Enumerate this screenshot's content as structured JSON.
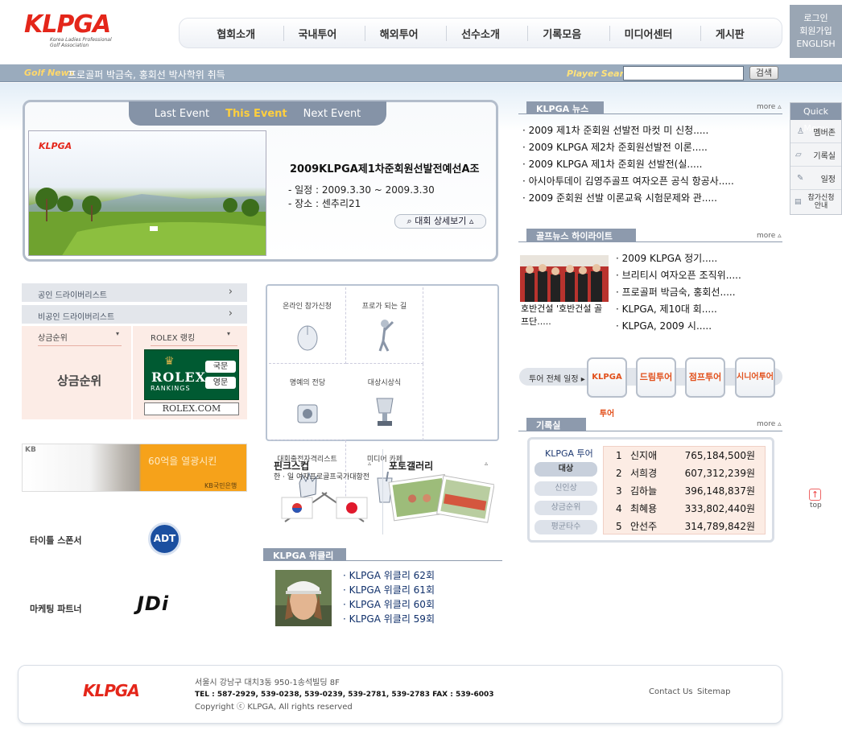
{
  "header": {
    "logo_text": "KLPGA",
    "logo_sub": "Korea Ladies Professional Golf Association",
    "nav": [
      "협회소개",
      "국내투어",
      "해외투어",
      "선수소개",
      "기록모음",
      "미디어센터",
      "게시판"
    ],
    "top_links": [
      "로그인",
      "회원가입",
      "ENGLISH"
    ]
  },
  "newsbar": {
    "label": "Golf News",
    "headline": "프로골퍼 박금숙, 홍회선 박사학위 취득",
    "search_label": "Player Search",
    "search_button": "검색"
  },
  "event": {
    "tabs": [
      "Last Event",
      "This Event",
      "Next Event"
    ],
    "title": "2009KLPGA제1차준회원선발전예선A조",
    "date": "- 일정 : 2009.3.30 ~ 2009.3.30",
    "venue": "- 장소 : 센추리21",
    "detail_button": "대회 상세보기"
  },
  "left": {
    "links": [
      "공인 드라이버리스트",
      "비공인 드라이버리스트"
    ],
    "prize_tab": "상금순위",
    "rolex_tab": "ROLEX 랭킹",
    "prize_title": "상금순위",
    "rolex_word": "ROLEX",
    "rolex_rankings": "RANKINGS",
    "rolex_kor": "국문",
    "rolex_eng": "영문",
    "rolex_site": "ROLEX.COM",
    "kb_logo": "KB",
    "kb_text": "60억을 열광시킨",
    "kb_bank": "KB국민은행",
    "sponsor_title": "타이틀 스폰서",
    "sponsor_logo": "ADT",
    "partner_title": "마케팅 파트너",
    "partner_logo": "JDi"
  },
  "grid": [
    "온라인 참가신청",
    "프로가 되는 길",
    "명예의 전당",
    "대상시상식",
    "대회출전자격리스트",
    "미디어 카페"
  ],
  "pinks": {
    "title": "핀크스컵",
    "subtitle": "한 · 일 여자프로골프국가대항전",
    "photo_title": "포토갤러리"
  },
  "weekly": {
    "header": "KLPGA 위클리",
    "items": [
      "· KLPGA 위클리 62회",
      "· KLPGA 위클리 61회",
      "· KLPGA 위클리 60회",
      "· KLPGA 위클리 59회"
    ]
  },
  "news": {
    "header": "KLPGA 뉴스",
    "more": "more ▵",
    "items": [
      "·  2009 제1차 준회원 선발전 마컷 미 신청.....",
      "·  2009 KLPGA 제2차 준회원선발전 이론.....",
      "·  2009 KLPGA 제1차 준회원 선발전(실.....",
      "·  아시아투데이 김영주골프 여자오픈 공식 항공사.....",
      "·  2009 준회원 선발 이론교육 시험문제와 관....."
    ]
  },
  "highlight": {
    "header": "골프뉴스 하이라이트",
    "more": "more ▵",
    "caption": "호반건설 '호반건설 골프단.....",
    "items": [
      "· 2009 KLPGA 정기.....",
      "· 브리티시 여자오픈 조직위.....",
      "· 프로골퍼 박금숙, 홍회선.....",
      "· KLPGA, 제10대 회.....",
      "· KLPGA, 2009 시....."
    ]
  },
  "tours": {
    "label": "투어 전체 일정 ▸",
    "items": [
      "KLPGA투어",
      "드림투어",
      "점프투어",
      "시니어투어"
    ]
  },
  "records": {
    "header": "기록실",
    "more": "more ▵",
    "tour": "KLPGA 투어",
    "tabs": [
      "대상",
      "신인상",
      "상금순위",
      "평균타수"
    ],
    "rows": [
      {
        "rank": "1",
        "name": "신지애",
        "amount": "765,184,500원"
      },
      {
        "rank": "2",
        "name": "서희경",
        "amount": "607,312,239원"
      },
      {
        "rank": "3",
        "name": "김하늘",
        "amount": "396,148,837원"
      },
      {
        "rank": "4",
        "name": "최혜용",
        "amount": "333,802,440원"
      },
      {
        "rank": "5",
        "name": "안선주",
        "amount": "314,789,842원"
      }
    ]
  },
  "quickmenu": {
    "header": "Quick Menu",
    "items": [
      "멤버존",
      "기록실",
      "일정",
      "참가신청 안내"
    ],
    "top": "top"
  },
  "footer": {
    "address": "서울시 강남구 대치3동 950-1송석빌딩 8F",
    "tel": "TEL : 587-2929, 539-0238, 539-0239, 539-2781, 539-2783     FAX : 539-6003",
    "copyright": "Copyright ⓒ KLPGA,   All rights reserved",
    "links": [
      "Contact Us",
      "Sitemap"
    ]
  },
  "colors": {
    "brand_red": "#e4261a",
    "bar_blue": "#9aabbd",
    "accent_orange": "#f6a21a",
    "rolex_green": "#005a32"
  }
}
